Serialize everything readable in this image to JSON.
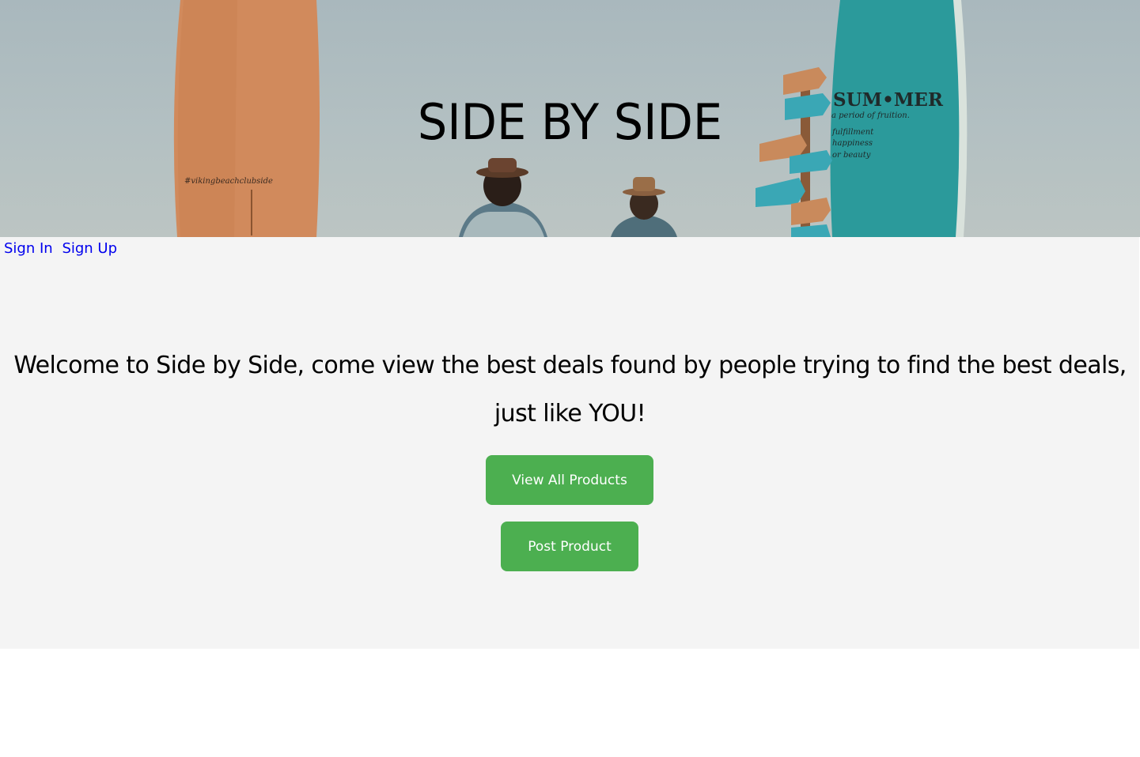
{
  "hero": {
    "title": "SIDE BY SIDE",
    "surfboard_text": "#vikingbeachclubside",
    "summer_text": "SUM•MER",
    "summer_sub": "a period of fruition.",
    "summer_lines": [
      "fulfillment",
      "happiness",
      "or beauty"
    ]
  },
  "nav": {
    "sign_in": "Sign In",
    "sign_up": "Sign Up"
  },
  "main": {
    "welcome_line1": "Welcome to Side by Side, come view the best deals found by people trying to find the best deals,",
    "welcome_line2": "just like YOU!",
    "view_all_label": "View All Products",
    "post_label": "Post Product"
  },
  "colors": {
    "button": "#4caf50",
    "link": "#0000ee",
    "main_bg": "#f4f4f4"
  }
}
